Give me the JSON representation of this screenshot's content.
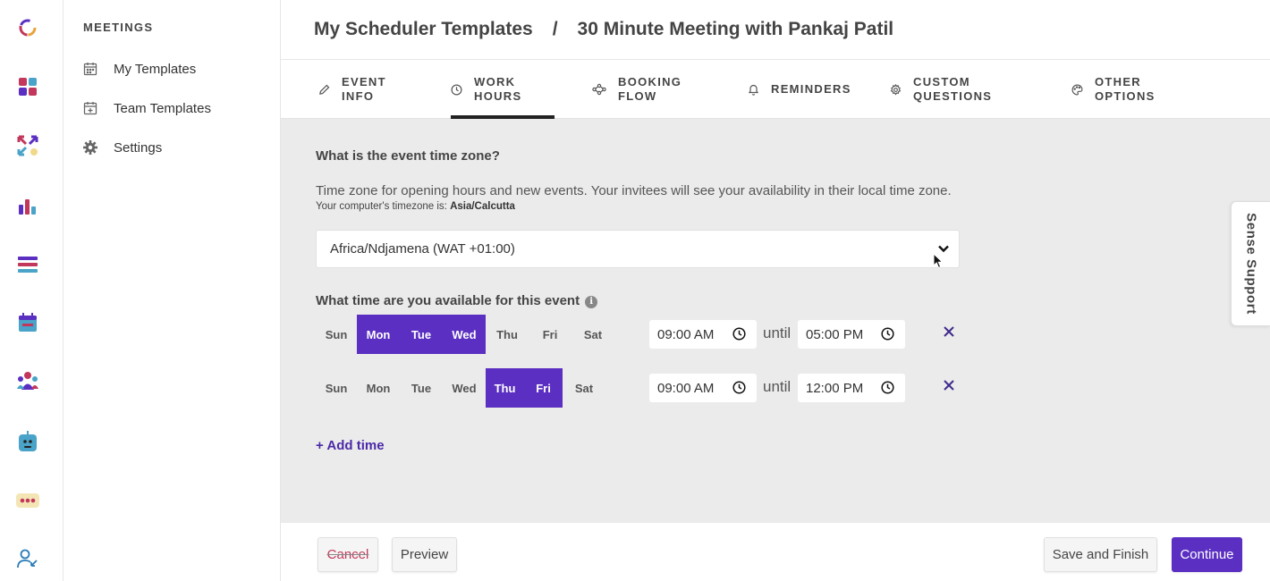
{
  "rail": {
    "icons": [
      "app-logo-icon",
      "dashboard-icon",
      "integrations-icon",
      "analytics-icon",
      "lists-icon",
      "calendar-icon",
      "team-icon",
      "bot-icon",
      "chat-icon",
      "user-icon"
    ]
  },
  "sidebar": {
    "heading": "MEETINGS",
    "items": [
      {
        "label": "My Templates",
        "icon": "calendar-icon"
      },
      {
        "label": "Team Templates",
        "icon": "calendar-plus-icon"
      },
      {
        "label": "Settings",
        "icon": "gear-icon"
      }
    ]
  },
  "header": {
    "crumb_root": "My Scheduler Templates",
    "separator": "/",
    "crumb_current": "30 Minute Meeting with Pankaj Patil"
  },
  "tabs": [
    {
      "label": "EVENT\nINFO",
      "icon": "pencil-icon",
      "active": false
    },
    {
      "label": "WORK\nHOURS",
      "icon": "clock-icon",
      "active": true
    },
    {
      "label": "BOOKING\nFLOW",
      "icon": "flow-icon",
      "active": false
    },
    {
      "label": "REMINDERS",
      "icon": "bell-icon",
      "active": false
    },
    {
      "label": "CUSTOM\nQUESTIONS",
      "icon": "gear-icon",
      "active": false
    },
    {
      "label": "OTHER\nOPTIONS",
      "icon": "palette-icon",
      "active": false
    }
  ],
  "timezone": {
    "question": "What is the event time zone?",
    "description": "Time zone for opening hours and new events. Your invitees will see your availability in their local time zone.",
    "local_prefix": "Your computer's timezone is: ",
    "local_value": "Asia/Calcutta",
    "selected": "Africa/Ndjamena (WAT +01:00)"
  },
  "availability": {
    "question": "What time are you available for this event",
    "until_label": "until",
    "day_labels": [
      "Sun",
      "Mon",
      "Tue",
      "Wed",
      "Thu",
      "Fri",
      "Sat"
    ],
    "rows": [
      {
        "selected": [
          "Mon",
          "Tue",
          "Wed"
        ],
        "start": "09:00 AM",
        "end": "05:00 PM"
      },
      {
        "selected": [
          "Thu",
          "Fri"
        ],
        "start": "09:00 AM",
        "end": "12:00 PM"
      }
    ],
    "add_time": "+ Add time"
  },
  "support_tab": "Sense Support",
  "footer": {
    "cancel": "Cancel",
    "preview": "Preview",
    "save_finish": "Save and Finish",
    "continue": "Continue"
  },
  "colors": {
    "accent": "#5a2fc2",
    "content_bg": "#ebebeb",
    "cancel_text": "#c0395a"
  }
}
